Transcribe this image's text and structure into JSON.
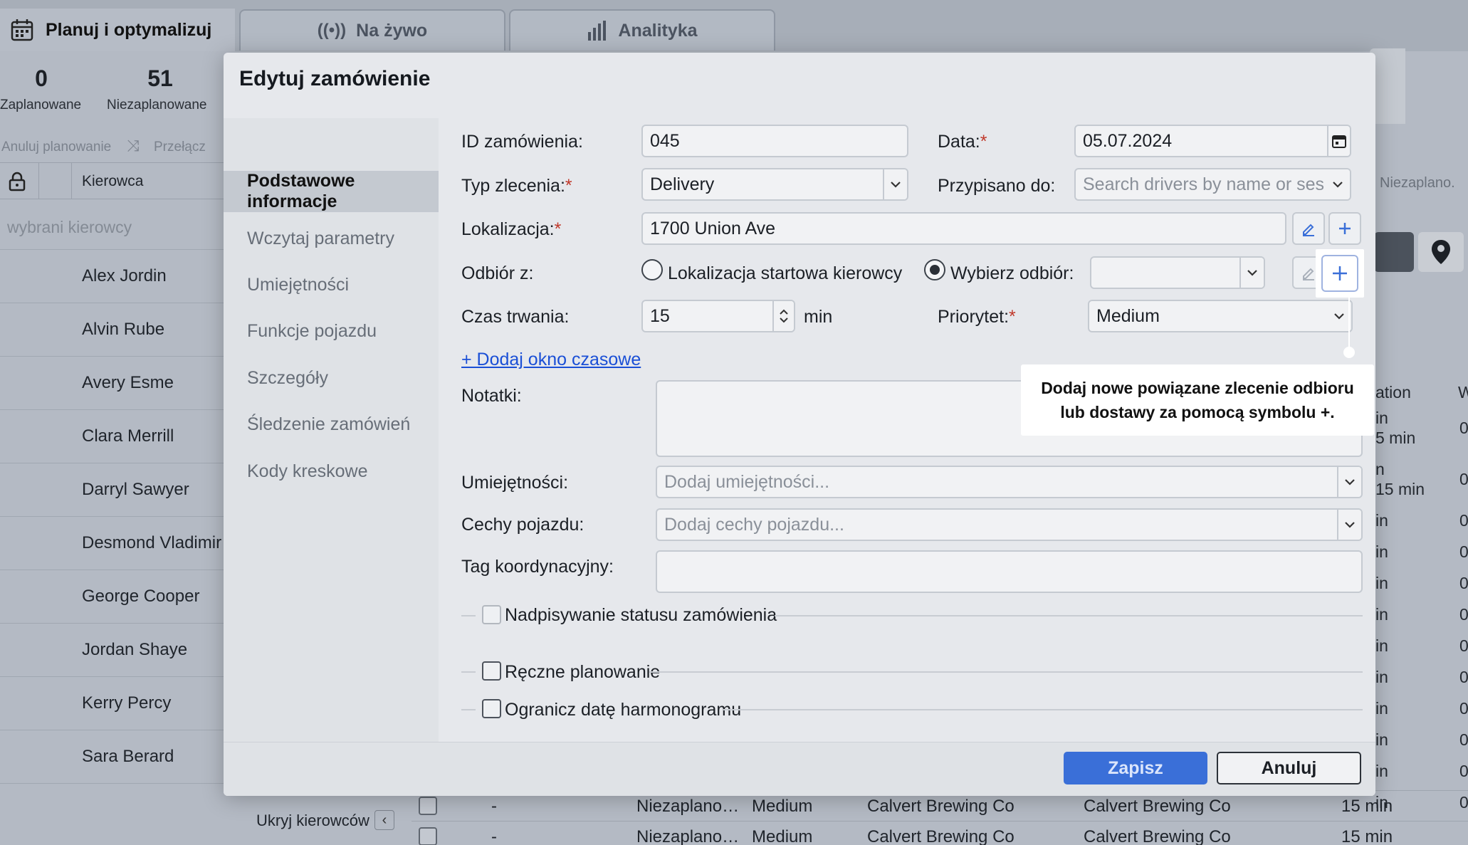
{
  "app": {
    "tabs": {
      "plan": "Planuj i optymalizuj",
      "live": "Na żywo",
      "analytics": "Analityka"
    }
  },
  "left_panel": {
    "stats": [
      {
        "value": "0",
        "label": "Zaplanowane"
      },
      {
        "value": "51",
        "label": "Niezaplanowane"
      }
    ],
    "actions": {
      "cancel_planning": "Anuluj planowanie",
      "switch": "Przełącz"
    },
    "column_driver": "Kierowca",
    "selected_drivers_placeholder": "wybrani kierowcy",
    "drivers": [
      "Alex Jordin",
      "Alvin Rube",
      "Avery Esme",
      "Clara Merrill",
      "Darryl Sawyer",
      "Desmond Vladimir",
      "George Cooper",
      "Jordan Shaye",
      "Kerry Percy",
      "Sara Berard"
    ],
    "hide_drivers": "Ukryj kierowców"
  },
  "right_panel": {
    "filter_value": "Niezaplano.",
    "col_duration": "ation",
    "col_w": "W",
    "cells": [
      "in",
      "5 min",
      "n",
      "15 min",
      "in",
      "in",
      "in",
      "in",
      "in",
      "in",
      "in",
      "in",
      "in",
      "in"
    ],
    "zeros": [
      "0",
      "0",
      "0",
      "0",
      "0",
      "0",
      "0",
      "0",
      "0",
      "0",
      "0",
      "0"
    ]
  },
  "bottom_rows": [
    {
      "dash": "-",
      "status": "Niezaplano…",
      "priority": "Medium",
      "customer": "Calvert Brewing Co",
      "location": "Calvert Brewing Co",
      "duration": "15 min"
    },
    {
      "dash": "-",
      "status": "Niezaplano…",
      "priority": "Medium",
      "customer": "Calvert Brewing Co",
      "location": "Calvert Brewing Co",
      "duration": "15 min"
    }
  ],
  "modal": {
    "title": "Edytuj zamówienie",
    "nav": [
      "Podstawowe informacje",
      "Wczytaj parametry",
      "Umiejętności",
      "Funkcje pojazdu",
      "Szczegóły",
      "Śledzenie zamówień",
      "Kody kreskowe"
    ],
    "form": {
      "order_id": {
        "label": "ID zamówienia:",
        "value": "045"
      },
      "date": {
        "label": "Data:",
        "value": "05.07.2024"
      },
      "order_type": {
        "label": "Typ zlecenia:",
        "value": "Delivery"
      },
      "assigned_to": {
        "label": "Przypisano do:",
        "placeholder": "Search drivers by name or ses"
      },
      "location": {
        "label": "Lokalizacja:",
        "value": "1700 Union Ave"
      },
      "pickup_from": {
        "label": "Odbiór z:",
        "option_start": "Lokalizacja startowa kierowcy",
        "option_choose": "Wybierz odbiór:",
        "selected": "option_choose"
      },
      "duration": {
        "label": "Czas trwania:",
        "value": "15",
        "unit": "min"
      },
      "priority": {
        "label": "Priorytet:",
        "value": "Medium"
      },
      "add_time_window": "+ Dodaj okno czasowe",
      "notes": {
        "label": "Notatki:",
        "value": ""
      },
      "skills": {
        "label": "Umiejętności:",
        "placeholder": "Dodaj umiejętności..."
      },
      "vehicle_features": {
        "label": "Cechy pojazdu:",
        "placeholder": "Dodaj cechy pojazdu..."
      },
      "coord_tag": {
        "label": "Tag koordynacyjny:",
        "value": ""
      },
      "status_override": {
        "label": "Nadpisywanie statusu zamówienia",
        "checked": false
      },
      "manual_planning": {
        "label": "Ręczne planowanie",
        "checked": false
      },
      "limit_schedule_date": {
        "label": "Ogranicz datę harmonogramu",
        "checked": false
      }
    },
    "buttons": {
      "save": "Zapisz",
      "cancel": "Anuluj"
    }
  },
  "tooltip": {
    "line1": "Dodaj nowe powiązane zlecenie odbioru",
    "line2": "lub dostawy za pomocą symbolu +."
  },
  "colors": {
    "accent": "#3a6fd8",
    "link": "#1a4fd6",
    "required": "#c0392b",
    "map_pin": "#1c2026"
  }
}
